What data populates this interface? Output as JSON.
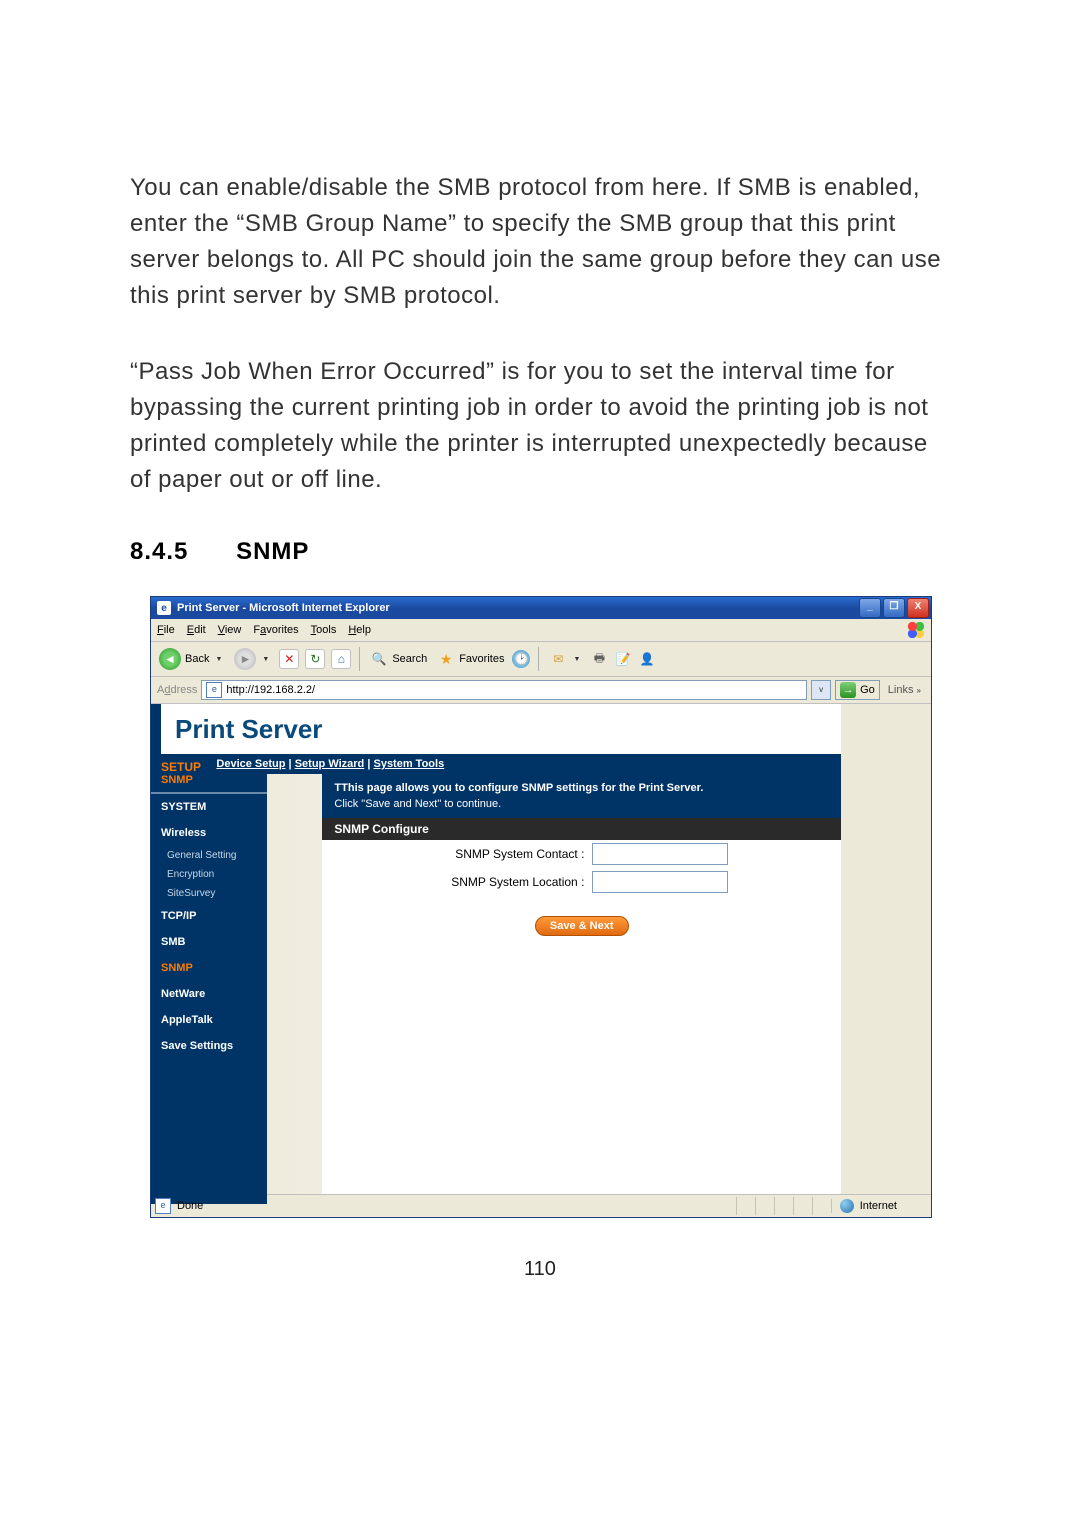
{
  "doc": {
    "para1": "You can enable/disable the SMB protocol from here. If SMB is enabled, enter the “SMB Group Name” to specify the SMB group that this print server belongs to. All PC should join the same group before they can use this print server by SMB protocol.",
    "para2": "“Pass Job When Error Occurred” is for you to set the interval time for bypassing the current printing job in order to avoid the printing job is not printed completely while the printer is interrupted unexpectedly because of paper out or off line.",
    "heading_num": "8.4.5",
    "heading_text": "SNMP",
    "page_number": "110"
  },
  "browser": {
    "title": "Print Server - Microsoft Internet Explorer",
    "menus": {
      "file": "File",
      "edit": "Edit",
      "view": "View",
      "favorites": "Favorites",
      "tools": "Tools",
      "help": "Help"
    },
    "toolbar": {
      "back": "Back",
      "search": "Search",
      "favorites": "Favorites"
    },
    "address": {
      "label": "Address",
      "url": "http://192.168.2.2/",
      "go": "Go",
      "links": "Links"
    },
    "status": {
      "text": "Done",
      "zone": "Internet"
    }
  },
  "app": {
    "logo": "Print Server",
    "tabs": {
      "device_setup": "Device Setup",
      "setup_wizard": "Setup Wizard",
      "system_tools": "System Tools",
      "sep": " | "
    },
    "sidebar": {
      "setup": "SETUP",
      "sub": "SNMP",
      "system": "SYSTEM",
      "wireless": "Wireless",
      "general_setting": "General Setting",
      "encryption": "Encryption",
      "sitesurvey": "SiteSurvey",
      "tcpip": "TCP/IP",
      "smb": "SMB",
      "snmp": "SNMP",
      "netware": "NetWare",
      "appletalk": "AppleTalk",
      "save_settings": "Save Settings"
    },
    "panel": {
      "desc1": "TThis page allows you to configure SNMP settings for the Print Server.",
      "desc2": "Click \"Save and Next\" to continue.",
      "header": "SNMP Configure",
      "contact_label": "SNMP System Contact :",
      "location_label": "SNMP System Location :",
      "contact_value": "",
      "location_value": "",
      "button": "Save & Next"
    }
  }
}
